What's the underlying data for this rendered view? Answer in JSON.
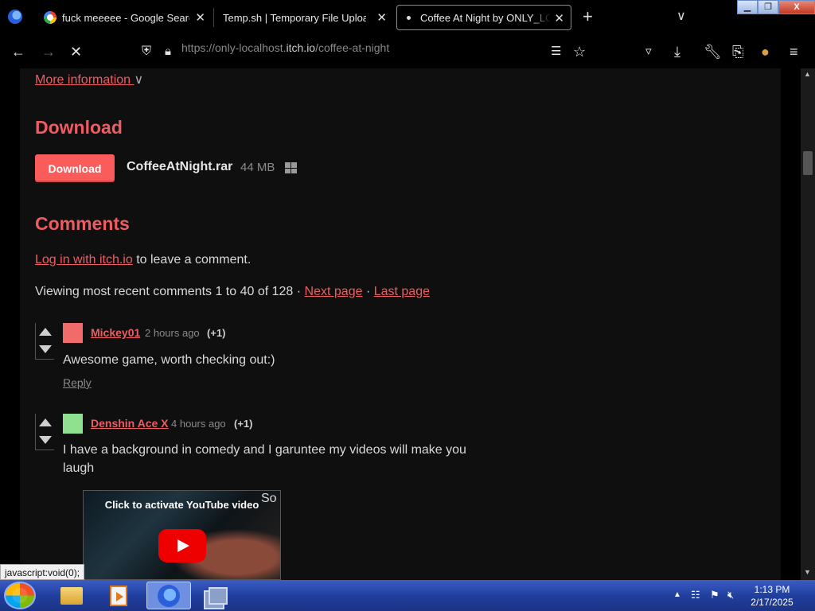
{
  "browser": {
    "tabs": [
      {
        "label": "fuck meeeee - Google Search",
        "icon": "google-icon"
      },
      {
        "label": "Temp.sh | Temporary File Upload",
        "icon": "none"
      },
      {
        "label": "Coffee At Night by ONLY_LOCALHOST",
        "icon": "loading-dot",
        "active": true
      }
    ],
    "url_prefix": "https://only-localhost.",
    "url_host": "itch.io",
    "url_path": "/coffee-at-night",
    "window_controls": {
      "minimize": "▁",
      "restore": "❐",
      "close": "X"
    }
  },
  "page": {
    "more_info": "More information",
    "download_heading": "Download",
    "download_button": "Download",
    "file_name": "CoffeeAtNight.rar",
    "file_size": "44 MB",
    "comments_heading": "Comments",
    "login_link": "Log in with itch.io",
    "login_suffix": "to leave a comment.",
    "viewing_text": "Viewing most recent comments 1 to 40 of 128 ·",
    "next_page": "Next page",
    "separator": "·",
    "last_page": "Last page",
    "comments": [
      {
        "author": "Mickey01",
        "time": "2 hours ago",
        "votes": "(+1)",
        "body_lines": [
          "Awesome game, worth checking out:)"
        ],
        "reply": "Reply",
        "avatar_color": "#f26b6b"
      },
      {
        "author": "Denshin Ace X",
        "time": "4 hours ago",
        "votes": "(+1)",
        "body_lines": [
          "I have a background in comedy and I garuntee my videos will make you",
          "laugh"
        ],
        "avatar_color": "#8fe08f"
      }
    ],
    "youtube_caption": "Click to activate YouTube video",
    "after_video_text": "So"
  },
  "status_bar": "javascript:void(0);",
  "taskbar": {
    "time": "1:13 PM",
    "date": "2/17/2025"
  }
}
